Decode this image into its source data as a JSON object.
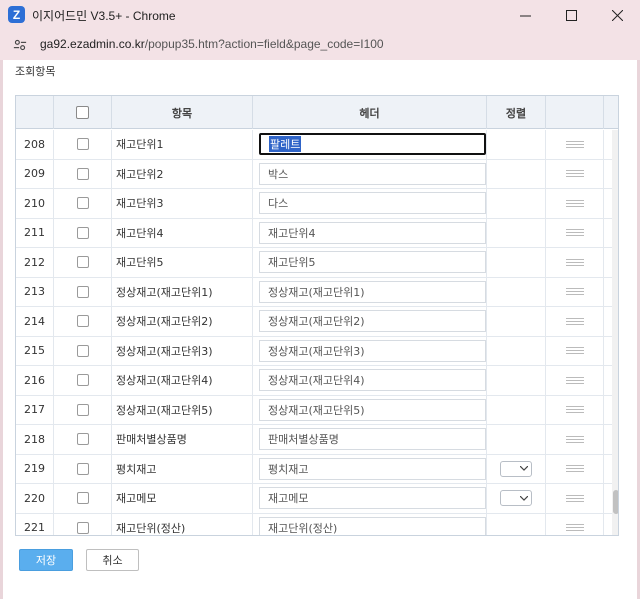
{
  "window": {
    "title": "이지어드민 V3.5+ - Chrome",
    "icon_letter": "Z",
    "url_host": "ga92.ezadmin.co.kr",
    "url_path": "/popup35.htm?action=field&page_code=I100"
  },
  "section_title": "조회항목",
  "columns": {
    "item": "항목",
    "header": "헤더",
    "sort": "정렬"
  },
  "rows": [
    {
      "no": "208",
      "item": "재고단위1",
      "header": "팔레트",
      "sort": false
    },
    {
      "no": "209",
      "item": "재고단위2",
      "header": "박스",
      "sort": false
    },
    {
      "no": "210",
      "item": "재고단위3",
      "header": "다스",
      "sort": false
    },
    {
      "no": "211",
      "item": "재고단위4",
      "header": "재고단위4",
      "sort": false
    },
    {
      "no": "212",
      "item": "재고단위5",
      "header": "재고단위5",
      "sort": false
    },
    {
      "no": "213",
      "item": "정상재고(재고단위1)",
      "header": "정상재고(재고단위1)",
      "sort": false
    },
    {
      "no": "214",
      "item": "정상재고(재고단위2)",
      "header": "정상재고(재고단위2)",
      "sort": false
    },
    {
      "no": "215",
      "item": "정상재고(재고단위3)",
      "header": "정상재고(재고단위3)",
      "sort": false
    },
    {
      "no": "216",
      "item": "정상재고(재고단위4)",
      "header": "정상재고(재고단위4)",
      "sort": false
    },
    {
      "no": "217",
      "item": "정상재고(재고단위5)",
      "header": "정상재고(재고단위5)",
      "sort": false
    },
    {
      "no": "218",
      "item": "판매처별상품명",
      "header": "판매처별상품명",
      "sort": false
    },
    {
      "no": "219",
      "item": "평치재고",
      "header": "평치재고",
      "sort": true
    },
    {
      "no": "220",
      "item": "재고메모",
      "header": "재고메모",
      "sort": true
    },
    {
      "no": "221",
      "item": "재고단위(정산)",
      "header": "재고단위(정산)",
      "sort": false
    }
  ],
  "buttons": {
    "save": "저장",
    "cancel": "취소"
  },
  "colors": {
    "chrome_bg": "#f3e2e6",
    "save_btn": "#5aaeee",
    "selection": "#2f64c8"
  }
}
